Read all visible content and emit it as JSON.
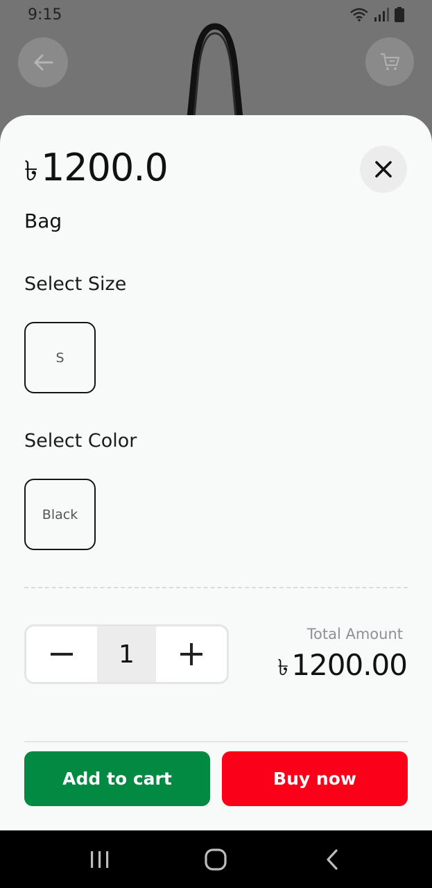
{
  "status_bar": {
    "time": "9:15",
    "icons": [
      "wifi-icon",
      "signal-icon",
      "battery-icon"
    ]
  },
  "header": {
    "back_icon": "arrow-left-icon",
    "cart_icon": "cart-icon"
  },
  "sheet": {
    "currency_symbol": "৳",
    "price": "1200.0",
    "product_name": "Bag",
    "close_icon": "close-icon",
    "size_section": {
      "label": "Select Size",
      "options": [
        "S"
      ]
    },
    "color_section": {
      "label": "Select Color",
      "options": [
        "Black"
      ]
    },
    "quantity": {
      "value": "1",
      "decrement_icon": "minus-icon",
      "increment_icon": "plus-icon"
    },
    "total": {
      "label": "Total Amount",
      "currency_symbol": "৳",
      "value": "1200.00"
    },
    "actions": {
      "add_to_cart": "Add to cart",
      "buy_now": "Buy now"
    }
  },
  "colors": {
    "add_to_cart_bg": "#028a43",
    "buy_now_bg": "#fb0019",
    "sheet_bg": "#f8f9f9"
  },
  "nav_bar": {
    "icons": [
      "recents-icon",
      "home-icon",
      "back-icon"
    ]
  }
}
